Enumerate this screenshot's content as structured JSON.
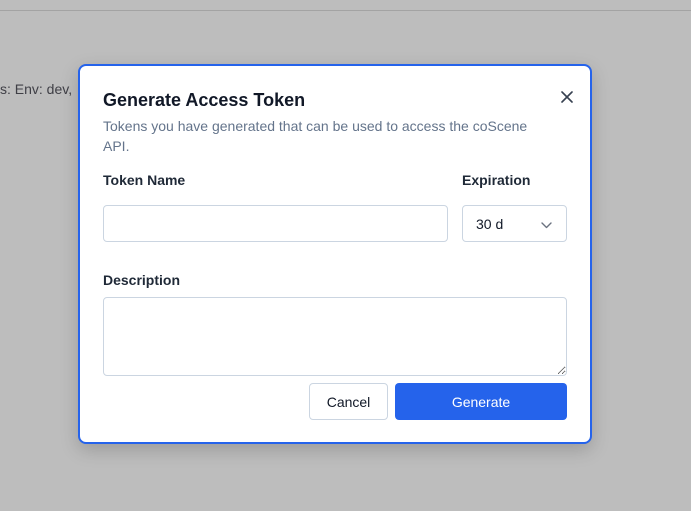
{
  "background": {
    "partial_text": "s: Env: dev,"
  },
  "dialog": {
    "title": "Generate Access Token",
    "subtitle": "Tokens you have generated that can be used to access the coScene API.",
    "token_name_label": "Token Name",
    "token_name_value": "",
    "expiration_label": "Expiration",
    "expiration_selected": "30 d",
    "description_label": "Description",
    "description_value": "",
    "cancel_label": "Cancel",
    "generate_label": "Generate"
  },
  "icons": {
    "close": "close-icon",
    "dropdown": "chevron-down-icon"
  },
  "colors": {
    "primary": "#2563eb",
    "overlay": "#bdbdbd",
    "subtitle_text": "#64748b"
  }
}
